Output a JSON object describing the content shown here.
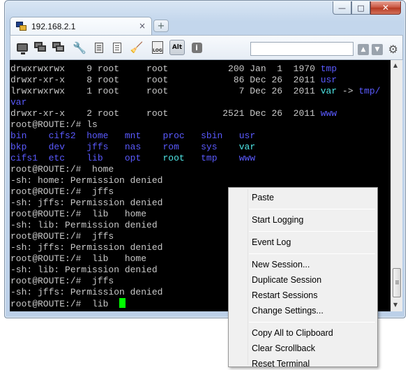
{
  "tab": {
    "title": "192.168.2.1",
    "close_glyph": "×",
    "new_tab_glyph": "+"
  },
  "caption": {
    "minimize": "—",
    "maximize": "□",
    "close": "✕"
  },
  "toolbar": {
    "icons": [
      "new-session-icon",
      "duplicate-session-icon",
      "sessions-icon",
      "settings-wrench-icon",
      "copy-icon",
      "paste-document-icon",
      "clear-broom-icon",
      "log-icon",
      "alt-key-icon",
      "info-icon"
    ],
    "log_label": "LOG",
    "alt_label": "Alt",
    "info_label": "i",
    "search_placeholder": "",
    "search_value": ""
  },
  "terminal": {
    "lines": [
      [
        {
          "t": "drwxrwxrwx    9 root     root           200 Jan  1  1970 ",
          "c": ""
        },
        {
          "t": "tmp",
          "c": "c-blue"
        }
      ],
      [
        {
          "t": "drwxr-xr-x    8 root     root            86 Dec 26  2011 ",
          "c": ""
        },
        {
          "t": "usr",
          "c": "c-blue"
        }
      ],
      [
        {
          "t": "lrwxrwxrwx    1 root     root             7 Dec 26  2011 ",
          "c": ""
        },
        {
          "t": "var",
          "c": "c-cyan"
        },
        {
          "t": " -> ",
          "c": ""
        },
        {
          "t": "tmp/",
          "c": "c-blue"
        }
      ],
      [
        {
          "t": "var",
          "c": "c-blue"
        }
      ],
      [
        {
          "t": "drwxr-xr-x    2 root     root          2521 Dec 26  2011 ",
          "c": ""
        },
        {
          "t": "www",
          "c": "c-blue"
        }
      ],
      [
        {
          "t": "root@ROUTE:/# ls",
          "c": ""
        }
      ],
      [
        {
          "t": "bin",
          "c": "c-blue"
        },
        {
          "t": "    ",
          "c": ""
        },
        {
          "t": "cifs2",
          "c": "c-blue"
        },
        {
          "t": "  ",
          "c": ""
        },
        {
          "t": "home",
          "c": "c-blue"
        },
        {
          "t": "   ",
          "c": ""
        },
        {
          "t": "mnt",
          "c": "c-blue"
        },
        {
          "t": "    ",
          "c": ""
        },
        {
          "t": "proc",
          "c": "c-blue"
        },
        {
          "t": "   ",
          "c": ""
        },
        {
          "t": "sbin",
          "c": "c-blue"
        },
        {
          "t": "   ",
          "c": ""
        },
        {
          "t": "usr",
          "c": "c-blue"
        }
      ],
      [
        {
          "t": "bkp",
          "c": "c-blue"
        },
        {
          "t": "    ",
          "c": ""
        },
        {
          "t": "dev",
          "c": "c-blue"
        },
        {
          "t": "    ",
          "c": ""
        },
        {
          "t": "jffs",
          "c": "c-blue"
        },
        {
          "t": "   ",
          "c": ""
        },
        {
          "t": "nas",
          "c": "c-blue"
        },
        {
          "t": "    ",
          "c": ""
        },
        {
          "t": "rom",
          "c": "c-blue"
        },
        {
          "t": "    ",
          "c": ""
        },
        {
          "t": "sys",
          "c": "c-blue"
        },
        {
          "t": "    ",
          "c": ""
        },
        {
          "t": "var",
          "c": "c-cyan"
        }
      ],
      [
        {
          "t": "cifs1",
          "c": "c-blue"
        },
        {
          "t": "  ",
          "c": ""
        },
        {
          "t": "etc",
          "c": "c-blue"
        },
        {
          "t": "    ",
          "c": ""
        },
        {
          "t": "lib",
          "c": "c-blue"
        },
        {
          "t": "    ",
          "c": ""
        },
        {
          "t": "opt",
          "c": "c-blue"
        },
        {
          "t": "    ",
          "c": ""
        },
        {
          "t": "root",
          "c": "c-cyan"
        },
        {
          "t": "   ",
          "c": ""
        },
        {
          "t": "tmp",
          "c": "c-blue"
        },
        {
          "t": "    ",
          "c": ""
        },
        {
          "t": "www",
          "c": "c-blue"
        }
      ],
      [
        {
          "t": "root@ROUTE:/#  home",
          "c": ""
        }
      ],
      [
        {
          "t": "-sh: home: Permission denied",
          "c": ""
        }
      ],
      [
        {
          "t": "root@ROUTE:/#  jffs",
          "c": ""
        }
      ],
      [
        {
          "t": "-sh: jffs: Permission denied",
          "c": ""
        }
      ],
      [
        {
          "t": "root@ROUTE:/#  lib   home",
          "c": ""
        }
      ],
      [
        {
          "t": "-sh: lib: Permission denied",
          "c": ""
        }
      ],
      [
        {
          "t": "root@ROUTE:/#  jffs",
          "c": ""
        }
      ],
      [
        {
          "t": "-sh: jffs: Permission denied",
          "c": ""
        }
      ],
      [
        {
          "t": "root@ROUTE:/#  lib   home",
          "c": ""
        }
      ],
      [
        {
          "t": "-sh: lib: Permission denied",
          "c": ""
        }
      ],
      [
        {
          "t": "root@ROUTE:/#  jffs",
          "c": ""
        }
      ],
      [
        {
          "t": "-sh: jffs: Permission denied",
          "c": ""
        }
      ],
      [
        {
          "t": "root@ROUTE:/#  lib  ",
          "c": ""
        }
      ]
    ],
    "colors": {
      "background": "#000000",
      "text": "#c8c8c8",
      "dir": "#5a5aff",
      "link": "#4ee6e6",
      "cursor": "#00ff00"
    }
  },
  "scrollbar": {
    "up_glyph": "▲",
    "down_glyph": "▼"
  },
  "context_menu": {
    "groups": [
      [
        "Paste"
      ],
      [
        "Start Logging"
      ],
      [
        "Event Log"
      ],
      [
        "New Session...",
        "Duplicate Session",
        "Restart Sessions",
        "Change Settings..."
      ],
      [
        "Copy All to Clipboard",
        "Clear Scrollback",
        "Reset Terminal"
      ]
    ]
  }
}
